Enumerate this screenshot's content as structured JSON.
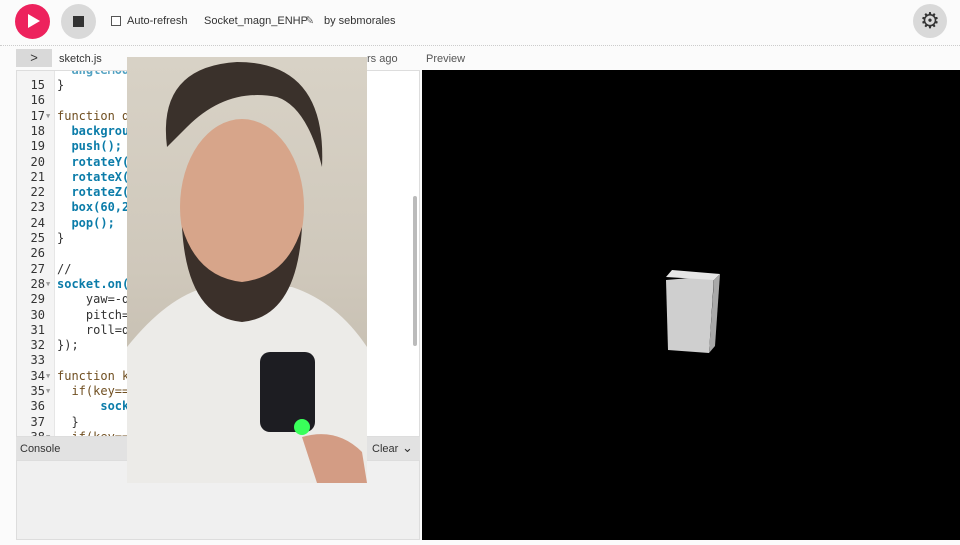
{
  "toolbar": {
    "play_icon": "play-icon",
    "stop_icon": "stop-icon",
    "auto_refresh": "Auto-refresh",
    "auto_refresh_checked": false,
    "sketch_name": "Socket_magn_ENHP",
    "edit_icon": "pencil-icon",
    "author": "by sebmorales",
    "settings_icon": "gear-icon"
  },
  "tabs": {
    "expand_icon": "chevron-right-icon",
    "file": "sketch.js",
    "saved_fragment": "rs ago",
    "preview": "Preview"
  },
  "editor": {
    "lines": [
      {
        "n": "15",
        "code": "}"
      },
      {
        "n": "16",
        "code": ""
      },
      {
        "n": "17",
        "code": "function d",
        "fold": true
      },
      {
        "n": "18",
        "code": "  backgrou"
      },
      {
        "n": "19",
        "code": "  push();"
      },
      {
        "n": "20",
        "code": "  rotateY("
      },
      {
        "n": "21",
        "code": "  rotateX("
      },
      {
        "n": "22",
        "code": "  rotateZ("
      },
      {
        "n": "23",
        "code": "  box(60,2"
      },
      {
        "n": "24",
        "code": "  pop();"
      },
      {
        "n": "25",
        "code": "}"
      },
      {
        "n": "26",
        "code": ""
      },
      {
        "n": "27",
        "code": "//"
      },
      {
        "n": "28",
        "code": "socket.on(",
        "fold": true
      },
      {
        "n": "29",
        "code": "    yaw=-d"
      },
      {
        "n": "30",
        "code": "    pitch="
      },
      {
        "n": "31",
        "code": "    roll=d"
      },
      {
        "n": "32",
        "code": "});"
      },
      {
        "n": "33",
        "code": ""
      },
      {
        "n": "34",
        "code": "function k",
        "fold": true
      },
      {
        "n": "35",
        "code": "  if(key==",
        "fold": true
      },
      {
        "n": "36",
        "code": "      sock"
      },
      {
        "n": "37",
        "code": "  }"
      },
      {
        "n": "38",
        "code": "  if(key==",
        "fold": true
      }
    ]
  },
  "console": {
    "label": "Console",
    "clear": "Clear",
    "collapse_icon": "chevron-down-icon"
  },
  "colors": {
    "accent": "#ed225d",
    "preview_bg": "#000000",
    "box": "#cfcfcf"
  }
}
